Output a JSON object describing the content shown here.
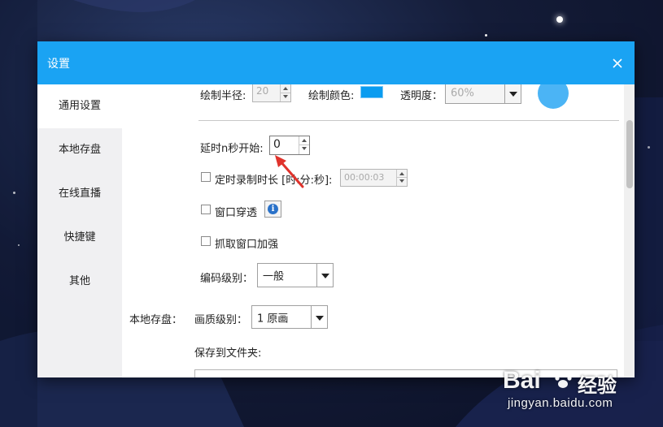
{
  "dialog": {
    "title": "设置",
    "close_icon": "close-icon"
  },
  "sidebar": {
    "items": [
      {
        "label": "通用设置",
        "active": true
      },
      {
        "label": "本地存盘",
        "active": false
      },
      {
        "label": "在线直播",
        "active": false
      },
      {
        "label": "快捷键",
        "active": false
      },
      {
        "label": "其他",
        "active": false
      }
    ]
  },
  "settings": {
    "draw_radius_label": "绘制半径:",
    "draw_radius_value": "20",
    "draw_color_label": "绘制颜色:",
    "draw_color": "#0a9cf0",
    "opacity_label": "透明度：",
    "opacity_value": "60%",
    "preview_color": "#4bb4f5",
    "delay_label": "延时n秒开始:",
    "delay_value": "0",
    "timed_record_label": "定时录制时长 [时:分:秒]:",
    "timed_record_value": "00:00:03",
    "timed_record_checked": false,
    "window_passthrough_label": "窗口穿透",
    "window_passthrough_checked": false,
    "info_icon": "info-icon",
    "capture_enhance_label": "抓取窗口加强",
    "capture_enhance_checked": false,
    "encode_level_label": "编码级别：",
    "encode_level_value": "一般"
  },
  "local_storage": {
    "section_label": "本地存盘：",
    "quality_label": "画质级别：",
    "quality_value": "1 原画",
    "save_folder_label": "保存到文件夹:"
  },
  "annotation": {
    "arrow_color": "#e0332c"
  },
  "watermark": {
    "logo": "Bai",
    "logo_cn": "经验",
    "url": "jingyan.baidu.com"
  }
}
